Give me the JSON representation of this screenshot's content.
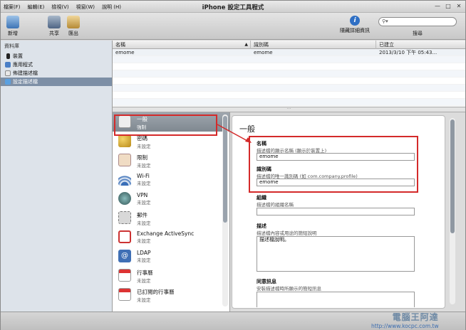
{
  "window": {
    "title": "iPhone 設定工具程式"
  },
  "menu": [
    "檔案(F)",
    "編輯(E)",
    "檢視(V)",
    "視窗(W)",
    "說明 (H)"
  ],
  "toolbar": {
    "new": "新增",
    "share": "共享",
    "export": "匯出",
    "hide_details": "隱藏詳細資訊",
    "search_label": "搜尋",
    "search_placeholder": ""
  },
  "sidebar": {
    "header": "資料庫",
    "items": [
      "裝置",
      "應用程式",
      "佈建描述檔",
      "設定描述檔"
    ],
    "selected": 3
  },
  "table": {
    "columns": [
      "名稱",
      "識別碼",
      "已建立"
    ],
    "rows": [
      [
        "emome",
        "emome",
        "2013/3/10 下午 05:43..."
      ]
    ]
  },
  "payloads": [
    {
      "title": "一般",
      "status": "強制"
    },
    {
      "title": "密碼",
      "status": "未設定"
    },
    {
      "title": "限制",
      "status": "未設定"
    },
    {
      "title": "Wi-Fi",
      "status": "未設定"
    },
    {
      "title": "VPN",
      "status": "未設定"
    },
    {
      "title": "郵件",
      "status": "未設定"
    },
    {
      "title": "Exchange ActiveSync",
      "status": "未設定"
    },
    {
      "title": "LDAP",
      "status": "未設定"
    },
    {
      "title": "行事曆",
      "status": "未設定"
    },
    {
      "title": "已訂閱的行事曆",
      "status": "未設定"
    }
  ],
  "detail": {
    "heading": "一般",
    "name": {
      "label": "名稱",
      "desc": "描述檔的顯示名稱 (顯示於裝置上)",
      "value": "emome"
    },
    "identifier": {
      "label": "識別碼",
      "desc": "描述檔的唯一識別碼 (如 com.company.profile)",
      "value": "emome"
    },
    "organization": {
      "label": "組織",
      "desc": "描述檔的組織名稱",
      "value": ""
    },
    "description": {
      "label": "描述",
      "desc": "描述檔內容或用途的簡短說明",
      "value": "描述檔說明。"
    },
    "consent": {
      "label": "同意訊息",
      "desc": "安裝描述檔時所顯示的簡短訊息",
      "value": ""
    }
  },
  "watermark": {
    "line1": "電腦王阿達",
    "line2": "http://www.kocpc.com.tw"
  },
  "colors": {
    "highlight_red": "#d42a2a",
    "sidebar_selected": "#7d8fa6"
  }
}
